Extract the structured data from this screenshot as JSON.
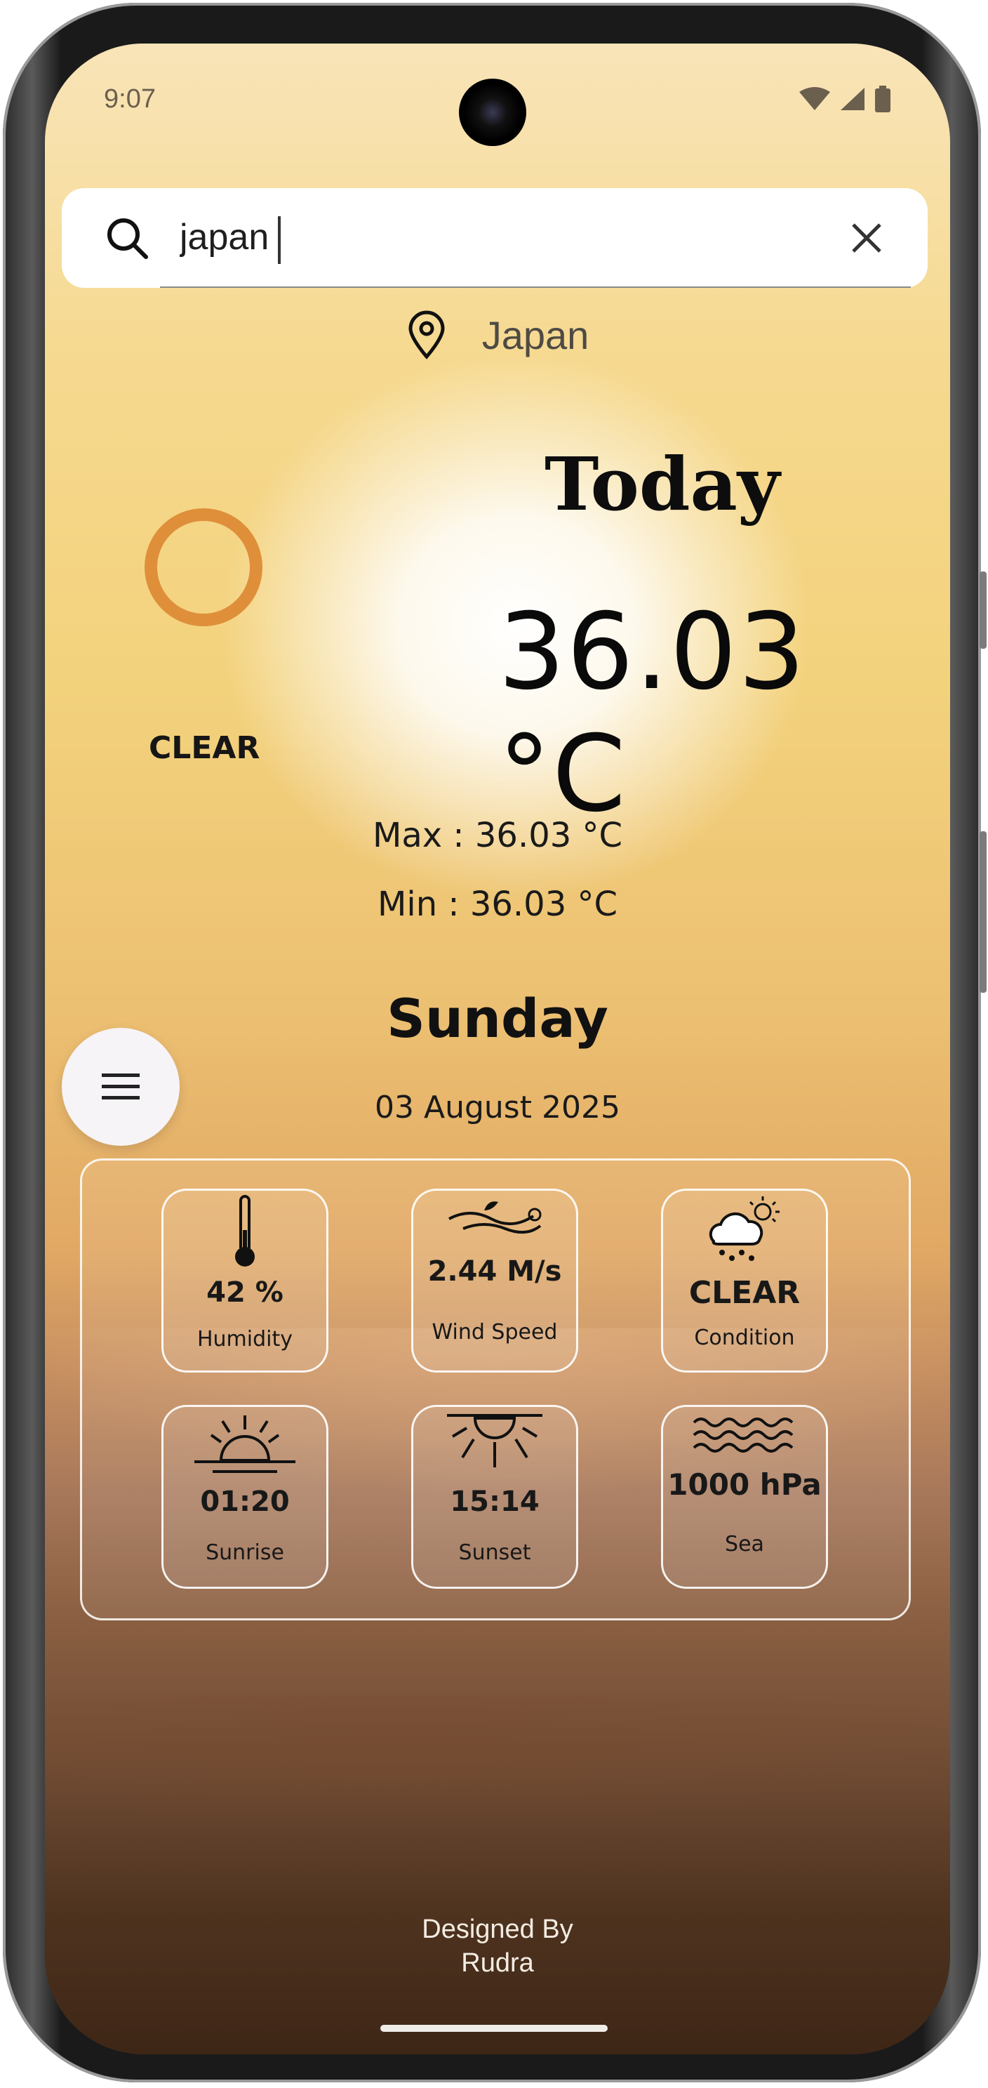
{
  "status": {
    "time": "9:07"
  },
  "search": {
    "value": "japan",
    "placeholder": ""
  },
  "location": {
    "name": "Japan"
  },
  "weather": {
    "heading": "Today",
    "temperature": "36.03 °C",
    "condition": "CLEAR",
    "max": "Max : 36.03 °C",
    "min": "Min : 36.03 °C",
    "day": "Sunday",
    "date": "03 August 2025"
  },
  "cards": [
    {
      "value": "42 %",
      "label": "Humidity",
      "icon": "thermometer-icon"
    },
    {
      "value": "2.44 M/s",
      "label": "Wind Speed",
      "icon": "wind-icon"
    },
    {
      "value": "CLEAR",
      "label": "Condition",
      "icon": "cloud-sun-rain-icon"
    },
    {
      "value": "01:20",
      "label": "Sunrise",
      "icon": "sunrise-icon"
    },
    {
      "value": "15:14",
      "label": "Sunset",
      "icon": "sunset-icon"
    },
    {
      "value": "1000 hPa",
      "label": "Sea",
      "icon": "waves-icon"
    }
  ],
  "footer": {
    "line1": "Designed By",
    "line2": "Rudra"
  },
  "colors": {
    "sun_ring": "#df8f3a",
    "text": "#111111",
    "card_border": "#ffffff"
  }
}
